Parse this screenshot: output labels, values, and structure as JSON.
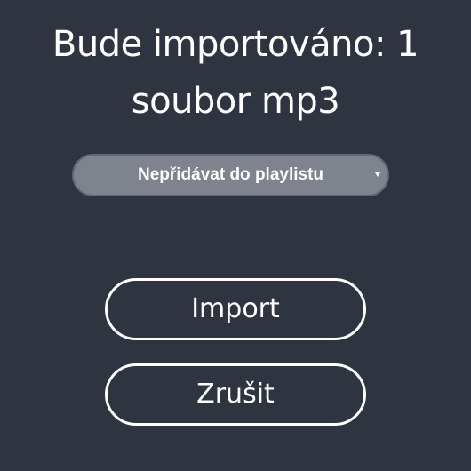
{
  "dialog": {
    "title_line1": "Bude importováno: 1",
    "title_line2": "soubor mp3",
    "playlist_select": {
      "selected_label": "Nepřidávat do playlistu"
    },
    "import_label": "Import",
    "cancel_label": "Zrušit"
  },
  "colors": {
    "background": "#2f3540",
    "select_fill": "#7e838d",
    "text": "#ffffff"
  }
}
